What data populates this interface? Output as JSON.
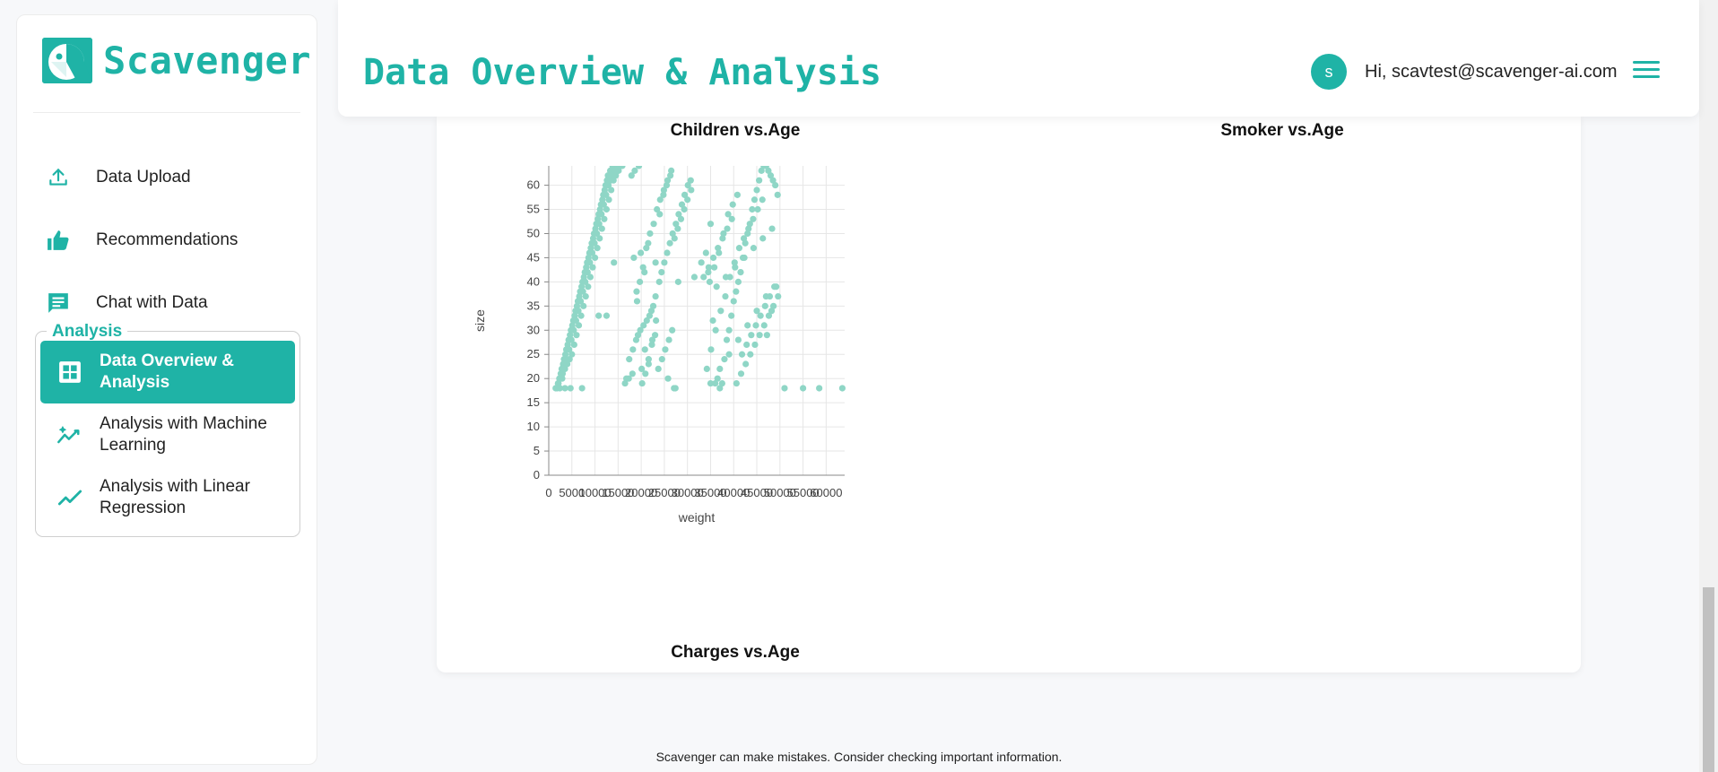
{
  "brand": {
    "name": "Scavenger",
    "accent": "#1fb3a6"
  },
  "sidebar": {
    "items": [
      {
        "label": "Data Upload",
        "icon": "upload-icon"
      },
      {
        "label": "Recommendations",
        "icon": "thumbs-up-icon"
      },
      {
        "label": "Chat with Data",
        "icon": "chat-icon"
      }
    ],
    "analysis": {
      "title": "Analysis",
      "items": [
        {
          "label": "Data Overview & Analysis",
          "icon": "grid-icon",
          "active": true
        },
        {
          "label": "Analysis with Machine Learning",
          "icon": "sparkle-chart-icon",
          "active": false
        },
        {
          "label": "Analysis with Linear Regression",
          "icon": "trend-line-icon",
          "active": false
        }
      ]
    }
  },
  "header": {
    "title": "Data Overview & Analysis",
    "avatar_letter": "s",
    "greeting": "Hi, scavtest@scavenger-ai.com",
    "menu_icon": "hamburger-icon"
  },
  "charts": {
    "titles": {
      "children": "Children vs.Age",
      "smoker": "Smoker vs.Age",
      "charges": "Charges vs.Age"
    }
  },
  "chart_data": {
    "type": "scatter",
    "title": "Charges vs.Age",
    "xlabel": "weight",
    "ylabel": "size",
    "xlim": [
      0,
      64000
    ],
    "ylim": [
      0,
      64
    ],
    "xticks": [
      0,
      5000,
      10000,
      15000,
      20000,
      25000,
      30000,
      35000,
      40000,
      45000,
      50000,
      55000,
      60000
    ],
    "yticks": [
      0,
      5,
      10,
      15,
      20,
      25,
      30,
      35,
      40,
      45,
      50,
      55,
      60
    ],
    "grid": true,
    "point_color": "#8fd6c6",
    "x": [
      1500,
      2000,
      2500,
      3000,
      3500,
      4000,
      4500,
      5000,
      5500,
      6000,
      6500,
      7000,
      7500,
      8000,
      8500,
      9000,
      9500,
      10000,
      10500,
      11000,
      11500,
      12000,
      12500,
      13000,
      13500,
      14000,
      14500,
      15000,
      1800,
      2300,
      2800,
      3300,
      3800,
      4300,
      4800,
      5300,
      5800,
      6300,
      6800,
      7300,
      7800,
      8300,
      8800,
      9300,
      9800,
      10300,
      10800,
      11300,
      11800,
      12300,
      12800,
      13300,
      13800,
      14300,
      14800,
      15300,
      2100,
      2600,
      3100,
      3600,
      4100,
      4600,
      5100,
      5600,
      6100,
      6600,
      7100,
      7600,
      8100,
      8600,
      9100,
      9600,
      10100,
      10600,
      11100,
      11600,
      12100,
      12600,
      13100,
      13600,
      14100,
      14600,
      15100,
      15600,
      2400,
      2900,
      3400,
      3900,
      4400,
      4900,
      5400,
      5900,
      6400,
      6900,
      7400,
      7900,
      8400,
      8900,
      9400,
      9900,
      10400,
      10900,
      11400,
      11900,
      12400,
      12900,
      13400,
      13900,
      14400,
      14900,
      15400,
      15900,
      3500,
      4700,
      7200,
      10800,
      12500,
      14100,
      16800,
      17400,
      18200,
      18900,
      19300,
      19800,
      20500,
      21200,
      21800,
      22600,
      23100,
      23900,
      24400,
      25000,
      25600,
      26200,
      26800,
      27500,
      28100,
      28800,
      29400,
      30100,
      30700,
      17900,
      18600,
      19500,
      20200,
      20900,
      21600,
      22300,
      23000,
      23700,
      24500,
      25200,
      26000,
      26700,
      27400,
      16500,
      17300,
      18100,
      19000,
      19700,
      20400,
      21100,
      21900,
      22700,
      23400,
      24100,
      24900,
      25700,
      26500,
      27200,
      27900,
      28600,
      29300,
      30000,
      30800,
      31500,
      18400,
      19100,
      19900,
      20700,
      21500,
      22200,
      23100,
      24000,
      24800,
      25500,
      26300,
      27100,
      20100,
      20800,
      21600,
      22400,
      23200,
      25800,
      28000,
      33000,
      34000,
      34500,
      35000,
      35500,
      36000,
      36500,
      37000,
      37500,
      38000,
      38500,
      39000,
      39500,
      40000,
      40500,
      41000,
      41500,
      42000,
      42500,
      43000,
      43500,
      44000,
      44500,
      45000,
      45500,
      46000,
      46500,
      47000,
      47500,
      48000,
      48500,
      49000,
      49500,
      34200,
      35100,
      36100,
      37200,
      38200,
      39200,
      40200,
      41200,
      42200,
      43200,
      44200,
      45200,
      46200,
      47200,
      48200,
      49200,
      34800,
      35800,
      36800,
      37800,
      38800,
      39800,
      40800,
      41800,
      42800,
      43800,
      44800,
      45800,
      46800,
      47800,
      48800,
      33500,
      34600,
      35600,
      36600,
      37600,
      38600,
      39600,
      40600,
      41600,
      42600,
      43600,
      44600,
      45600,
      46600,
      47600,
      48600,
      49600,
      36300,
      38300,
      40300,
      42300,
      44300,
      46300,
      48300,
      35000,
      37000,
      39000,
      41000,
      43000,
      45000,
      47000,
      51000,
      55000,
      58500,
      63500
    ],
    "y": [
      18,
      19,
      20,
      21,
      22,
      23,
      24,
      25,
      27,
      29,
      31,
      33,
      35,
      37,
      39,
      41,
      43,
      45,
      47,
      49,
      51,
      53,
      55,
      57,
      59,
      61,
      62,
      64,
      18,
      20,
      22,
      24,
      26,
      28,
      30,
      32,
      34,
      36,
      38,
      40,
      42,
      44,
      46,
      48,
      50,
      52,
      54,
      56,
      58,
      60,
      62,
      63,
      64,
      63,
      64,
      64,
      19,
      21,
      23,
      25,
      27,
      29,
      31,
      33,
      35,
      37,
      39,
      41,
      43,
      45,
      47,
      49,
      51,
      53,
      55,
      57,
      59,
      61,
      62,
      63,
      64,
      64,
      63,
      64,
      18,
      20,
      22,
      24,
      26,
      28,
      30,
      32,
      34,
      36,
      38,
      40,
      42,
      44,
      46,
      48,
      50,
      52,
      54,
      56,
      58,
      60,
      61,
      62,
      63,
      64,
      64,
      64,
      18,
      18,
      18,
      33,
      33,
      44,
      20,
      24,
      26,
      28,
      29,
      30,
      31,
      32,
      33,
      35,
      37,
      40,
      42,
      44,
      46,
      48,
      50,
      52,
      54,
      56,
      58,
      60,
      61,
      62,
      63,
      64,
      19,
      21,
      23,
      27,
      29,
      22,
      24,
      26,
      28,
      30,
      18,
      19,
      20,
      21,
      38,
      40,
      43,
      47,
      50,
      52,
      55,
      57,
      59,
      61,
      63,
      49,
      51,
      53,
      55,
      57,
      59,
      41,
      45,
      36,
      46,
      42,
      48,
      34,
      44,
      54,
      58,
      60,
      62,
      18,
      22,
      26,
      24,
      28,
      32,
      20,
      40,
      44,
      46,
      42,
      52,
      32,
      19,
      20,
      18,
      19,
      24,
      28,
      30,
      33,
      36,
      38,
      40,
      42,
      45,
      48,
      50,
      52,
      55,
      57,
      59,
      61,
      63,
      64,
      64,
      63,
      62,
      61,
      60,
      58,
      22,
      26,
      30,
      34,
      37,
      41,
      44,
      47,
      49,
      51,
      53,
      55,
      57,
      29,
      34,
      39,
      40,
      43,
      46,
      50,
      54,
      56,
      58,
      25,
      27,
      29,
      31,
      33,
      35,
      37,
      39,
      41,
      43,
      45,
      47,
      49,
      51,
      53,
      19,
      21,
      23,
      25,
      27,
      29,
      31,
      33,
      35,
      37,
      39,
      41,
      43,
      45,
      47,
      49,
      51,
      19,
      22,
      25,
      28,
      31,
      34,
      37,
      18,
      18,
      18,
      18,
      18,
      18,
      18,
      28,
      33,
      31,
      54
    ]
  },
  "footer": {
    "disclaimer": "Scavenger can make mistakes. Consider checking important information."
  }
}
